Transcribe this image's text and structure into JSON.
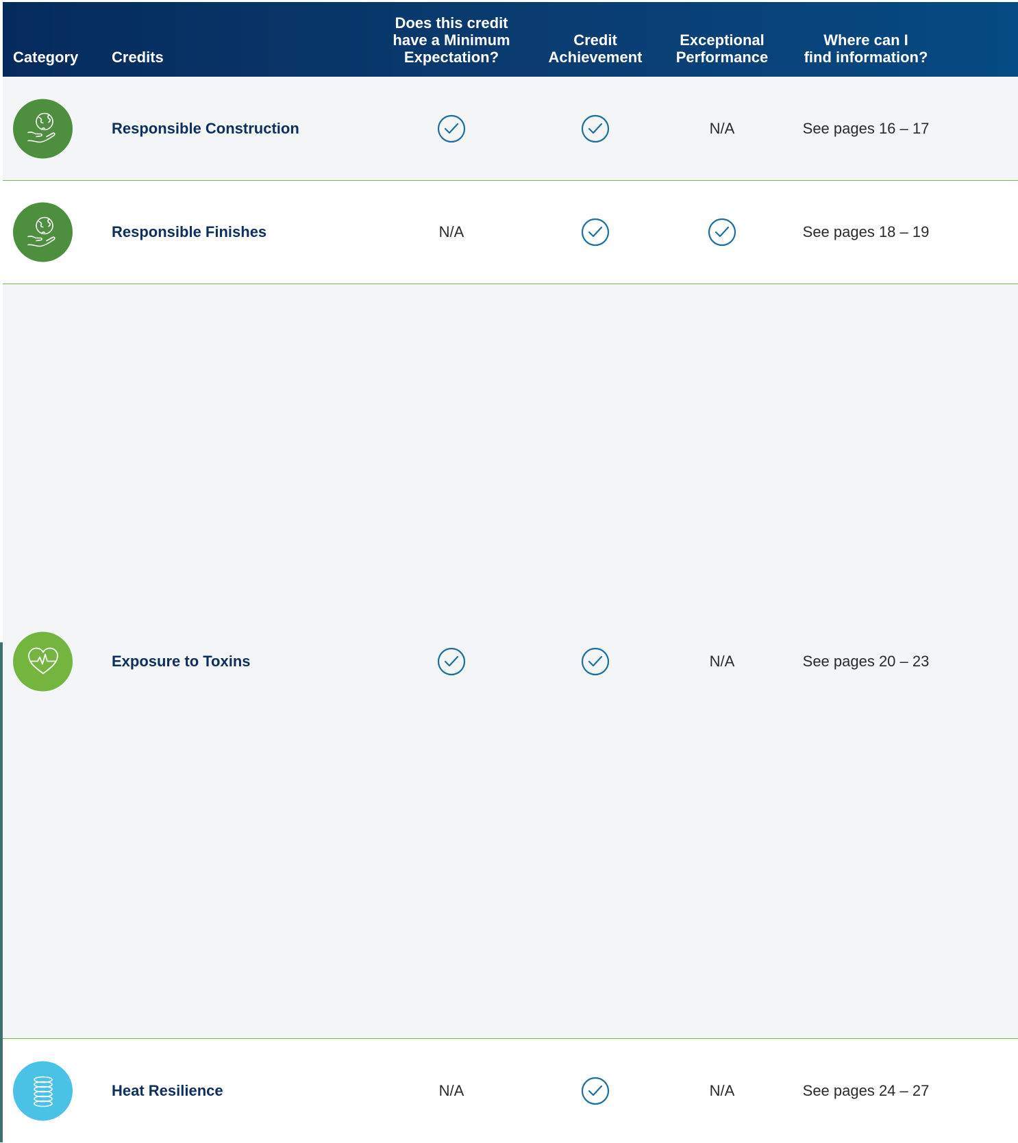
{
  "header": {
    "category": "Category",
    "credits": "Credits",
    "minimum_expectation": "Does this credit\nhave a Minimum\nExpectation?",
    "credit_achievement": "Credit\nAchievement",
    "exceptional_performance": "Exceptional\nPerformance",
    "where_info": "Where can I\nfind information?"
  },
  "colors": {
    "header_dark": "#052b5c",
    "title_text": "#0c2f5e",
    "check_blue": "#1a6fa3",
    "divider_green": "#78b84a"
  },
  "rows": [
    {
      "icon": "globe-hand-icon",
      "icon_color": "#4e8e3f",
      "credit": "Responsible Construction",
      "minimum_expectation": "check",
      "credit_achievement": "check",
      "exceptional_performance": "N/A",
      "pages": "See pages 16 – 17"
    },
    {
      "icon": "globe-hand-icon",
      "icon_color": "#4e8e3f",
      "credit": "Responsible Finishes",
      "minimum_expectation": "N/A",
      "credit_achievement": "check",
      "exceptional_performance": "check",
      "pages": "See pages 18 – 19"
    },
    {
      "icon": "heart-pulse-icon",
      "icon_color": "#74b540",
      "credit": "Exposure to Toxins",
      "minimum_expectation": "check",
      "credit_achievement": "check",
      "exceptional_performance": "N/A",
      "pages": "See pages 20 – 23"
    },
    {
      "icon": "coil-icon",
      "icon_color": "#4ac2e6",
      "credit": "Heat Resilience",
      "minimum_expectation": "N/A",
      "credit_achievement": "check",
      "exceptional_performance": "N/A",
      "pages": "See pages 24 – 27"
    }
  ]
}
